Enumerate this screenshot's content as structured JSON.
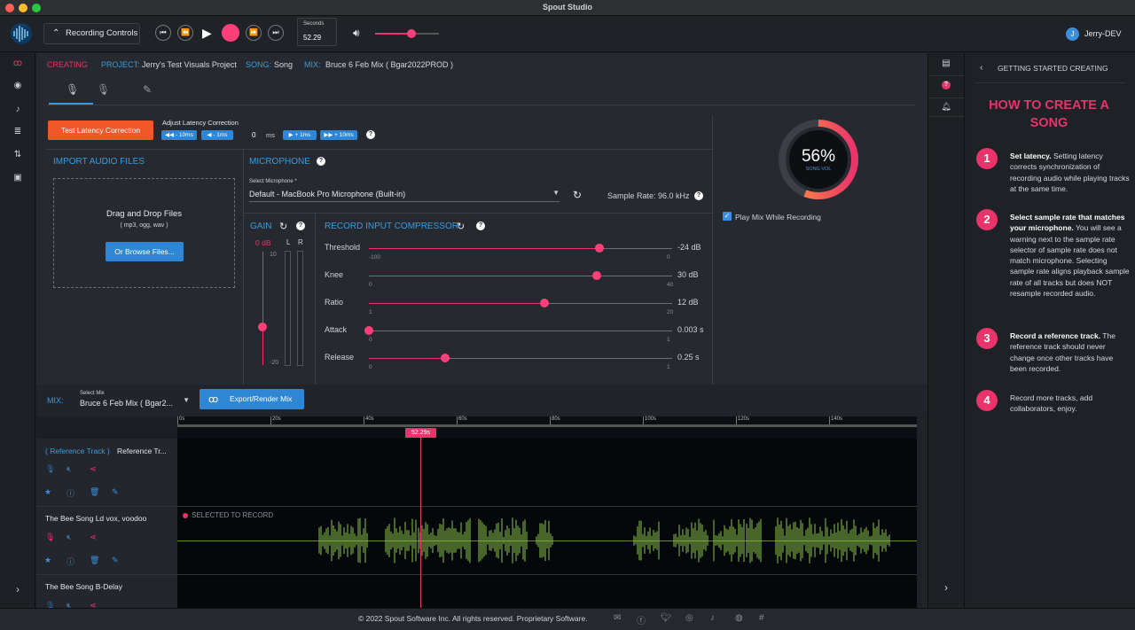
{
  "window": {
    "title": "Spout Studio"
  },
  "topbar": {
    "recording_controls": "Recording Controls",
    "seconds_label": "Seconds",
    "seconds_value": "52.29",
    "user_initial": "J",
    "user_name": "Jerry-DEV",
    "volume_level": 0.57
  },
  "breadcrumb": {
    "creating": "CREATING",
    "project_label": "PROJECT:",
    "project_value": "Jerry's Test Visuals Project",
    "song_label": "SONG:",
    "song_value": "Song",
    "mix_label": "MIX:",
    "mix_value": "Bruce 6 Feb Mix ( Bgar2022PROD )"
  },
  "latency": {
    "test_button": "Test Latency Correction",
    "adjust_label": "Adjust Latency Correction",
    "minus10": "◀◀ - 10ms",
    "minus1": "◀ - 1ms",
    "value": "0",
    "unit": "ms",
    "plus1": "▶ + 1ms",
    "plus10": "▶▶ + 10ms"
  },
  "import": {
    "title": "IMPORT AUDIO FILES",
    "drag": "Drag and Drop Files",
    "formats": "( mp3, ogg, wav )",
    "browse": "Or Browse Files..."
  },
  "microphone": {
    "title": "MICROPHONE",
    "select_label": "Select Microphone *",
    "selected": "Default - MacBook Pro Microphone (Built-in)",
    "sample_rate": "Sample Rate: 96.0 kHz"
  },
  "gain": {
    "title": "GAIN",
    "value": "0 dB",
    "l": "L",
    "r": "R",
    "top": "10",
    "bottom": "-20"
  },
  "compressor": {
    "title": "RECORD INPUT COMPRESSOR",
    "rows": [
      {
        "label": "Threshold",
        "value": "-24 dB",
        "min": "-100",
        "max": "0",
        "pos": 0.76
      },
      {
        "label": "Knee",
        "value": "30 dB",
        "min": "0",
        "max": "40",
        "pos": 0.75
      },
      {
        "label": "Ratio",
        "value": "12 dB",
        "min": "1",
        "max": "20",
        "pos": 0.58
      },
      {
        "label": "Attack",
        "value": "0.003 s",
        "min": "0",
        "max": "1",
        "pos": 0.0
      },
      {
        "label": "Release",
        "value": "0.25 s",
        "min": "0",
        "max": "1",
        "pos": 0.25
      }
    ]
  },
  "songvol": {
    "value": "56%",
    "label": "SONG VOL",
    "play_mix": "Play Mix While Recording"
  },
  "mix": {
    "label": "MIX:",
    "select_label": "Select Mix",
    "selected": "Bruce 6 Feb Mix ( Bgar2...",
    "export": "Export/Render Mix"
  },
  "timeline": {
    "ticks": [
      "0s",
      "20s",
      "40s",
      "60s",
      "80s",
      "100s",
      "120s",
      "140s"
    ],
    "playhead": "52.29s"
  },
  "tracks": [
    {
      "name_prefix": "( Reference Track )",
      "name": "Reference Tr..."
    },
    {
      "name": "The Bee Song Ld vox, voodoo",
      "badge": "SELECTED TO RECORD"
    },
    {
      "name": "The Bee Song B-Delay"
    }
  ],
  "guide": {
    "header": "GETTING STARTED CREATING",
    "title": "HOW TO CREATE A SONG",
    "steps": [
      {
        "n": "1",
        "bold": "Set latency.",
        "text": " Setting latency corrects synchronization of recording audio while playing tracks at the same time."
      },
      {
        "n": "2",
        "bold": "Select sample rate that matches your microphone.",
        "text": " You will see a warning next to the sample rate selector of sample rate does not match microphone. Selecting sample rate aligns playback sample rate of all tracks but does NOT resample recorded audio."
      },
      {
        "n": "3",
        "bold": "Record a reference track.",
        "text": " The reference track should never change once other tracks have been recorded."
      },
      {
        "n": "4",
        "bold": "",
        "text": "Record more tracks, add collaborators, enjoy."
      }
    ]
  },
  "footer": {
    "text": "© 2022 Spout Software Inc. All rights reserved. Proprietary Software."
  },
  "colors": {
    "accent": "#e8336b",
    "blue": "#3a9bdc",
    "orange": "#f0582a",
    "wave": "#8bc34a"
  }
}
